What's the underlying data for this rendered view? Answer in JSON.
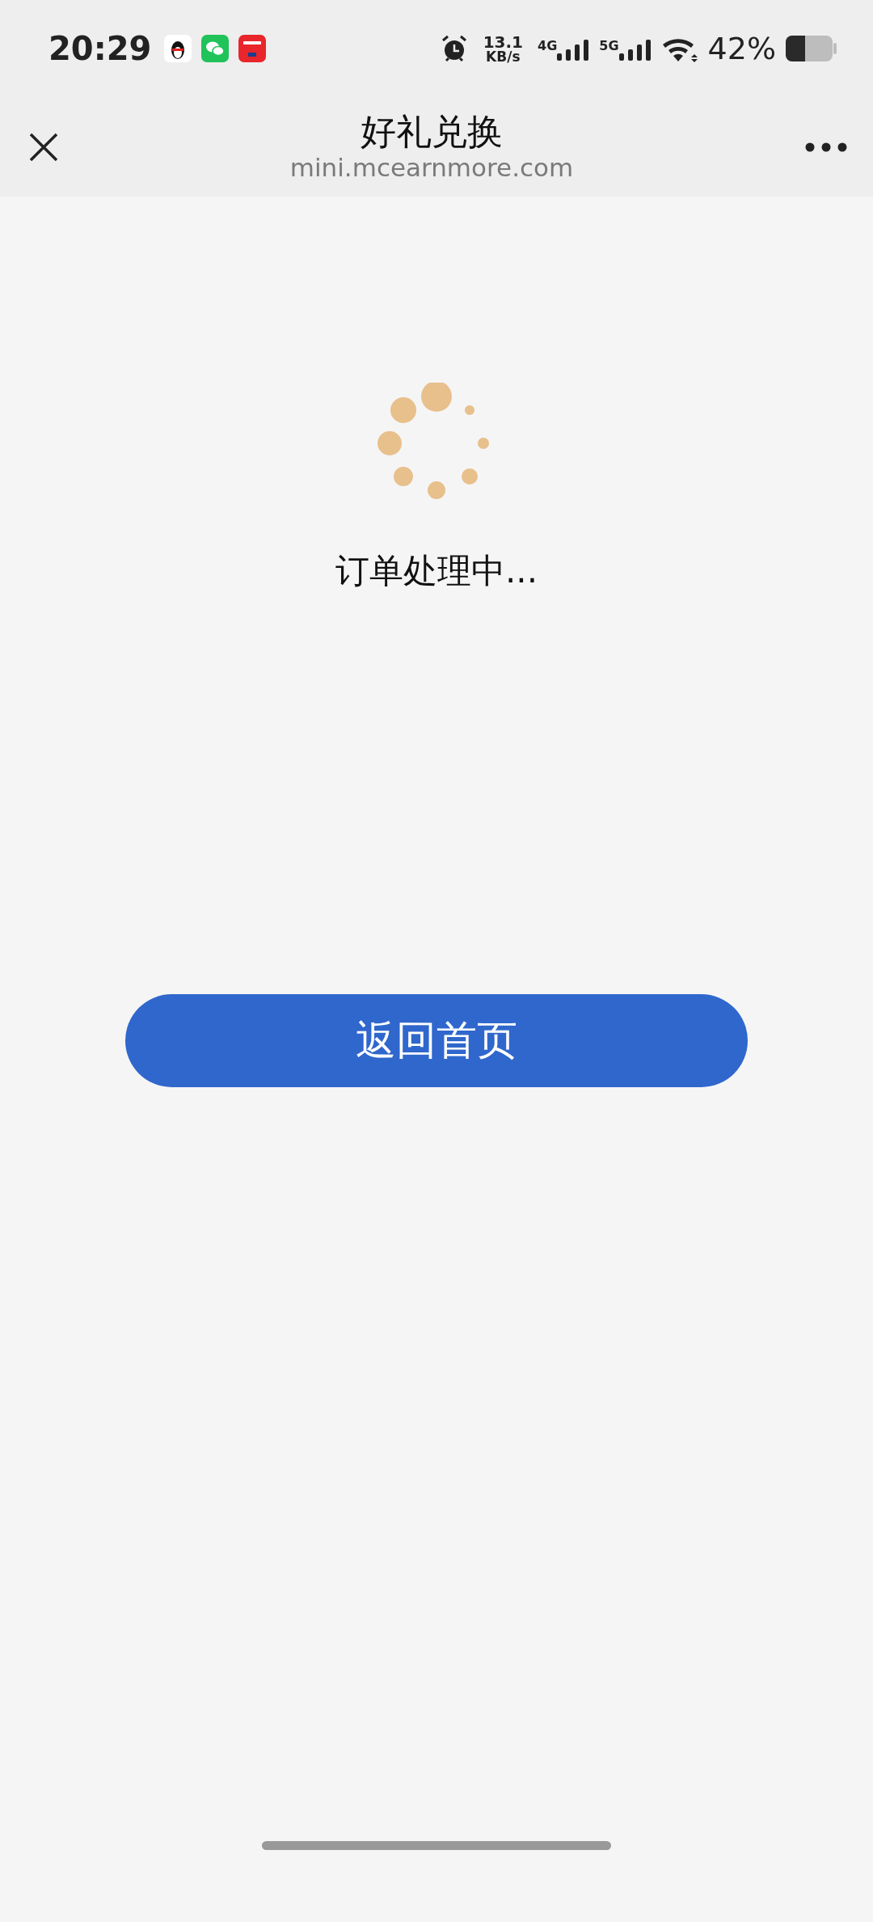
{
  "status_bar": {
    "time": "20:29",
    "net_speed": {
      "value": "13.1",
      "unit": "KB/s"
    },
    "signals": [
      {
        "label": "4G"
      },
      {
        "label": "5G"
      }
    ],
    "battery_percent": "42%"
  },
  "nav_bar": {
    "title": "好礼兑换",
    "url": "mini.mcearnmore.com"
  },
  "loading": {
    "message": "订单处理中..."
  },
  "buttons": [
    {
      "label": "返回首页"
    }
  ]
}
